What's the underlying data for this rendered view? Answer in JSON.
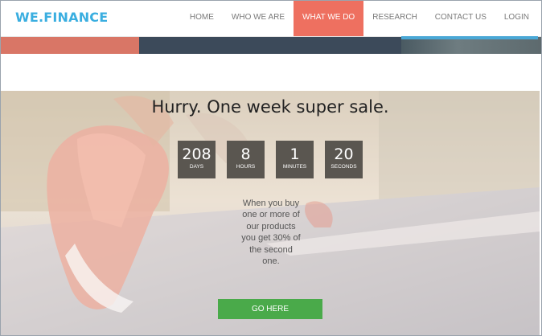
{
  "header": {
    "logo": "WE.FINANCE",
    "nav": [
      {
        "label": "HOME",
        "active": false
      },
      {
        "label": "WHO WE ARE",
        "active": false
      },
      {
        "label": "WHAT WE DO",
        "active": true
      },
      {
        "label": "RESEARCH",
        "active": false
      },
      {
        "label": "CONTACT US",
        "active": false
      },
      {
        "label": "LOGIN",
        "active": false
      }
    ]
  },
  "hero": {
    "title": "Hurry. One week super sale.",
    "countdown": [
      {
        "value": "208",
        "unit": "DAYS"
      },
      {
        "value": "8",
        "unit": "HOURS"
      },
      {
        "value": "1",
        "unit": "MINUTES"
      },
      {
        "value": "20",
        "unit": "SECONDS"
      }
    ],
    "promo_text": "When you buy one or more of our products you get 30% of the second one.",
    "cta_label": "GO HERE"
  },
  "colors": {
    "brand": "#3aaee0",
    "nav_active": "#ee7060",
    "cta": "#4aaa4a",
    "counter_bg": "#5a5650"
  }
}
